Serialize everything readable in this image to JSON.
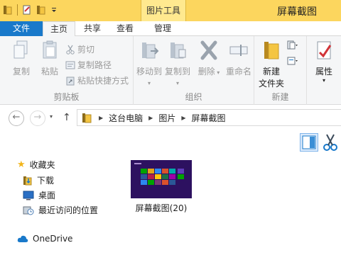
{
  "window": {
    "title": "屏幕截图",
    "context_tab": "图片工具"
  },
  "tabs": [
    {
      "label": "文件"
    },
    {
      "label": "主页"
    },
    {
      "label": "共享"
    },
    {
      "label": "查看"
    },
    {
      "label": "管理"
    }
  ],
  "ribbon": {
    "clipboard": {
      "label": "剪贴板",
      "copy": "复制",
      "paste": "粘贴",
      "cut": "剪切",
      "copy_path": "复制路径",
      "paste_shortcut": "粘贴快捷方式"
    },
    "organize": {
      "label": "组织",
      "move_to": "移动到",
      "copy_to": "复制到",
      "delete": "删除",
      "rename": "重命名"
    },
    "new": {
      "label": "新建",
      "new_folder_line1": "新建",
      "new_folder_line2": "文件夹"
    },
    "open": {
      "properties": "属性"
    }
  },
  "address": {
    "crumbs": [
      "这台电脑",
      "图片",
      "屏幕截图"
    ]
  },
  "nav": {
    "favorites": "收藏夹",
    "downloads": "下载",
    "desktop": "桌面",
    "recent": "最近访问的位置",
    "onedrive": "OneDrive"
  },
  "files": [
    {
      "name": "屏幕截图(20)"
    }
  ],
  "colors": {
    "title_bar": "#fcd65e",
    "file_tab": "#1979ca",
    "thumbnail_bg": "#2d1160"
  }
}
